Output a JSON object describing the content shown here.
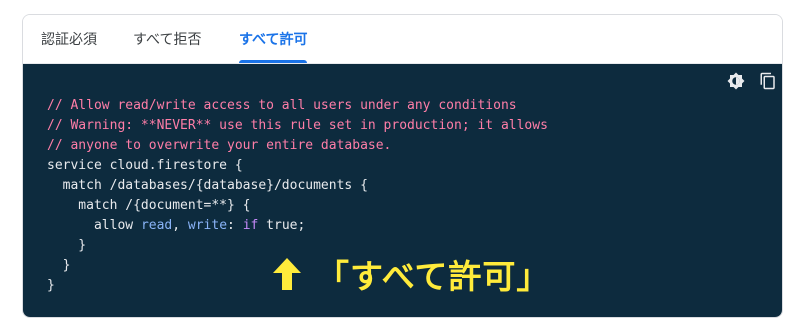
{
  "tabs": [
    {
      "label": "認証必須"
    },
    {
      "label": "すべて拒否"
    },
    {
      "label": "すべて許可"
    }
  ],
  "active_tab": "すべて許可",
  "toolbar": {
    "theme_icon": "theme-toggle-icon",
    "copy_icon": "copy-icon"
  },
  "code": {
    "line1": "// Allow read/write access to all users under any conditions",
    "line2": "// Warning: **NEVER** use this rule set in production; it allows",
    "line3": "// anyone to overwrite your entire database.",
    "line4": "service cloud.firestore {",
    "line5": "  match /databases/{database}/documents {",
    "line6": "    match /{document=**} {",
    "line7_indent": "      ",
    "line7_allow": "allow",
    "line7_read": "read",
    "line7_comma": ", ",
    "line7_write": "write",
    "line7_colon": ": ",
    "line7_if": "if",
    "line7_rest": " true;",
    "line8": "    }",
    "line9": "  }",
    "line10": "}"
  },
  "callout": {
    "text": "「すべて許可」",
    "arrow_icon": "up-arrow-icon"
  },
  "colors": {
    "accent": "#1a73e8",
    "code_bg": "#0d2b3e",
    "comment": "#ff7ea8",
    "callout": "#ffeb3b"
  }
}
